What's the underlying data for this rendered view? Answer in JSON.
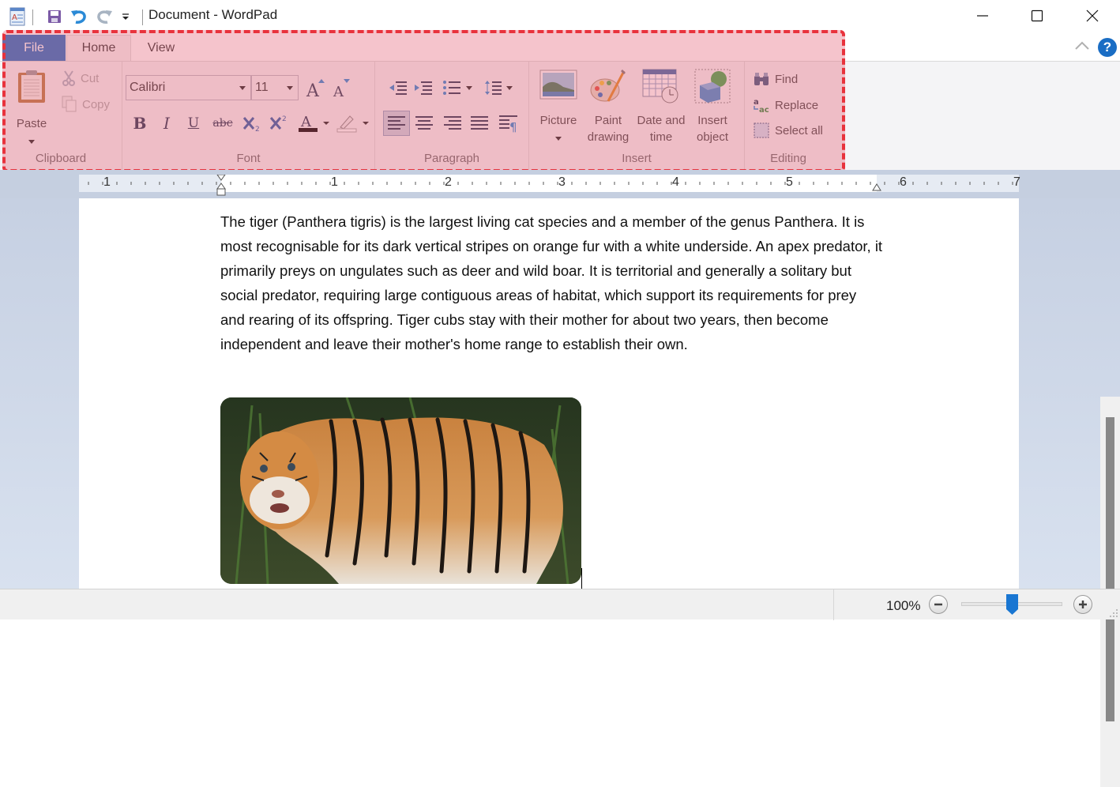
{
  "window": {
    "title": "Document - WordPad",
    "icons": {
      "app": "wordpad-app-icon",
      "save": "save-icon",
      "undo": "undo-icon",
      "redo": "redo-icon",
      "customize": "customize-quick-access-icon"
    },
    "controls": {
      "minimize": "minimize-icon",
      "maximize": "maximize-icon",
      "close": "close-icon"
    }
  },
  "tabs": [
    {
      "label": "File"
    },
    {
      "label": "Home"
    },
    {
      "label": "View"
    }
  ],
  "ribbon_right": {
    "collapse": "collapse-ribbon-icon",
    "help": "?"
  },
  "ribbon": {
    "clipboard": {
      "label": "Clipboard",
      "paste": "Paste",
      "cut": "Cut",
      "copy": "Copy"
    },
    "font": {
      "label": "Font",
      "family": "Calibri",
      "size": "11",
      "buttons": [
        "B",
        "I",
        "U",
        "abc"
      ]
    },
    "paragraph": {
      "label": "Paragraph"
    },
    "insert": {
      "label": "Insert",
      "picture": "Picture",
      "paint_line1": "Paint",
      "paint_line2": "drawing",
      "datetime_line1": "Date and",
      "datetime_line2": "time",
      "object_line1": "Insert",
      "object_line2": "object"
    },
    "editing": {
      "label": "Editing",
      "find": "Find",
      "replace": "Replace",
      "select_all": "Select all"
    }
  },
  "ruler": {
    "labels": [
      "1",
      "1",
      "2",
      "3",
      "4",
      "5",
      "6",
      "7"
    ]
  },
  "document": {
    "paragraph": "The tiger (Panthera tigris) is the largest living cat species and a member of the genus Panthera. It is most recognisable for its dark vertical stripes on orange fur with a white underside. An apex predator, it primarily preys on ungulates such as deer and wild boar. It is territorial and generally a solitary but social predator, requiring large contiguous areas of habitat, which support its requirements for prey and rearing of its offspring. Tiger cubs stay with their mother for about two years, then become independent and leave their mother's home range to establish their own.",
    "image_alt": "Tiger standing in grass"
  },
  "status": {
    "zoom": "100%",
    "zoom_level_fraction": 0.5
  },
  "highlight_color": "#e8323c"
}
